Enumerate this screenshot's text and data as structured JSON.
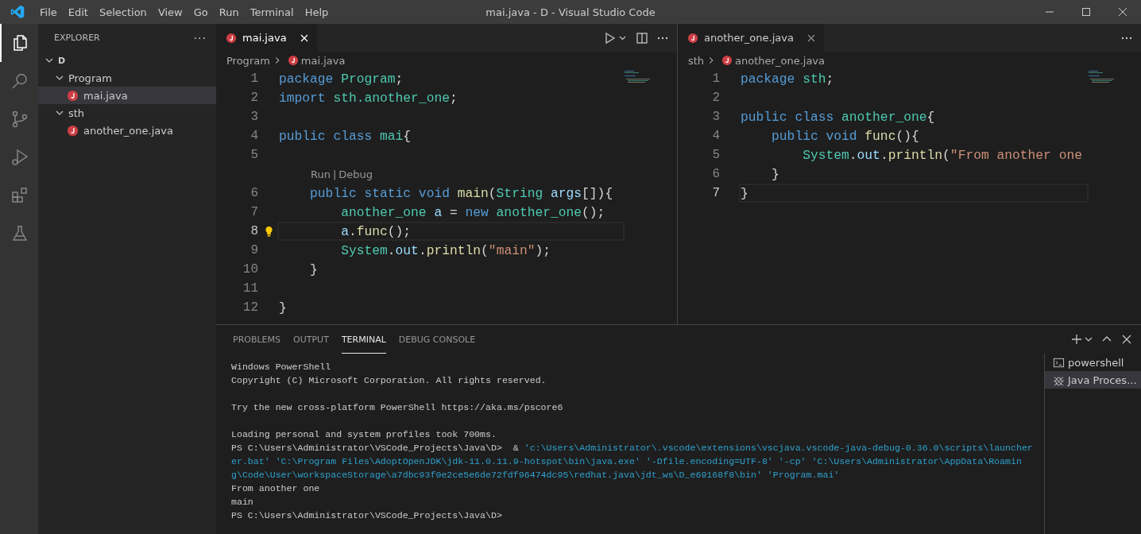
{
  "window": {
    "title": "mai.java - D - Visual Studio Code"
  },
  "menu": [
    "File",
    "Edit",
    "Selection",
    "View",
    "Go",
    "Run",
    "Terminal",
    "Help"
  ],
  "activity_bar": [
    {
      "kind": "files",
      "selected": true
    },
    {
      "kind": "search",
      "selected": false
    },
    {
      "kind": "source-control",
      "selected": false
    },
    {
      "kind": "run-debug",
      "selected": false
    },
    {
      "kind": "extensions",
      "selected": false
    },
    {
      "kind": "testing",
      "selected": false
    }
  ],
  "explorer": {
    "title": "EXPLORER",
    "more": "···",
    "tree": [
      {
        "label": "D",
        "kind": "folder",
        "expanded": true,
        "selected": false,
        "children": [
          {
            "label": "Program",
            "kind": "folder",
            "expanded": true,
            "selected": false,
            "children": [
              {
                "label": "mai.java",
                "kind": "java",
                "selected": true
              }
            ]
          },
          {
            "label": "sth",
            "kind": "folder",
            "expanded": true,
            "selected": false,
            "children": [
              {
                "label": "another_one.java",
                "kind": "java",
                "selected": false
              }
            ]
          }
        ]
      }
    ]
  },
  "editor_groups": [
    {
      "focused": true,
      "tabs": [
        {
          "label": "mai.java",
          "selected": true
        }
      ],
      "actions": [
        {
          "kind": "run"
        },
        {
          "kind": "split"
        },
        {
          "kind": "more"
        }
      ],
      "breadcrumb": [
        {
          "label": "Program",
          "kind": "folder"
        },
        {
          "label": "mai.java",
          "kind": "java"
        }
      ],
      "lines": [
        {
          "n": "1",
          "tokens": [
            {
              "t": "package ",
              "kind": "kw"
            },
            {
              "t": "Program",
              "kind": "type"
            },
            {
              "t": ";",
              "kind": "plain"
            }
          ]
        },
        {
          "n": "2",
          "tokens": [
            {
              "t": "import ",
              "kind": "kw"
            },
            {
              "t": "sth.another_one",
              "kind": "type"
            },
            {
              "t": ";",
              "kind": "plain"
            }
          ]
        },
        {
          "n": "3"
        },
        {
          "n": "4",
          "tokens": [
            {
              "t": "public class ",
              "kind": "kw"
            },
            {
              "t": "mai",
              "kind": "type"
            },
            {
              "t": "{",
              "kind": "plain"
            }
          ]
        },
        {
          "n": "5"
        },
        {
          "kind": "codelens",
          "links": [
            "Run",
            "Debug"
          ],
          "separator": "|"
        },
        {
          "n": "6",
          "tokens": [
            {
              "t": "    public static void ",
              "kind": "kw"
            },
            {
              "t": "main",
              "kind": "fn"
            },
            {
              "t": "(",
              "kind": "plain"
            },
            {
              "t": "String",
              "kind": "type"
            },
            {
              "t": " args",
              "kind": "var"
            },
            {
              "t": "[]){",
              "kind": "plain"
            }
          ]
        },
        {
          "n": "7",
          "tokens": [
            {
              "t": "        another_one",
              "kind": "type"
            },
            {
              "t": " a",
              "kind": "var"
            },
            {
              "t": " = ",
              "kind": "plain"
            },
            {
              "t": "new ",
              "kind": "kw"
            },
            {
              "t": "another_one",
              "kind": "type"
            },
            {
              "t": "();",
              "kind": "plain"
            }
          ]
        },
        {
          "n": "8",
          "current": true,
          "lightbulb": true,
          "tokens": [
            {
              "t": "        a",
              "kind": "var"
            },
            {
              "t": ".",
              "kind": "plain"
            },
            {
              "t": "func",
              "kind": "fn"
            },
            {
              "t": "();",
              "kind": "plain"
            }
          ]
        },
        {
          "n": "9",
          "tokens": [
            {
              "t": "        System",
              "kind": "type"
            },
            {
              "t": ".",
              "kind": "plain"
            },
            {
              "t": "out",
              "kind": "var"
            },
            {
              "t": ".",
              "kind": "plain"
            },
            {
              "t": "println",
              "kind": "fn"
            },
            {
              "t": "(",
              "kind": "plain"
            },
            {
              "t": "\"main\"",
              "kind": "str"
            },
            {
              "t": ");",
              "kind": "plain"
            }
          ]
        },
        {
          "n": "10",
          "tokens": [
            {
              "t": "    }",
              "kind": "plain"
            }
          ]
        },
        {
          "n": "11"
        },
        {
          "n": "12",
          "tokens": [
            {
              "t": "}",
              "kind": "plain"
            }
          ]
        }
      ]
    },
    {
      "focused": false,
      "tabs": [
        {
          "label": "another_one.java",
          "selected": true
        }
      ],
      "actions": [
        {
          "kind": "more"
        }
      ],
      "breadcrumb": [
        {
          "label": "sth",
          "kind": "folder"
        },
        {
          "label": "another_one.java",
          "kind": "java"
        }
      ],
      "lines": [
        {
          "n": "1",
          "tokens": [
            {
              "t": "package ",
              "kind": "kw"
            },
            {
              "t": "sth",
              "kind": "type"
            },
            {
              "t": ";",
              "kind": "plain"
            }
          ]
        },
        {
          "n": "2"
        },
        {
          "n": "3",
          "tokens": [
            {
              "t": "public class ",
              "kind": "kw"
            },
            {
              "t": "another_one",
              "kind": "type"
            },
            {
              "t": "{",
              "kind": "plain"
            }
          ]
        },
        {
          "n": "4",
          "tokens": [
            {
              "t": "    public void ",
              "kind": "kw"
            },
            {
              "t": "func",
              "kind": "fn"
            },
            {
              "t": "(){",
              "kind": "plain"
            }
          ]
        },
        {
          "n": "5",
          "tokens": [
            {
              "t": "        System",
              "kind": "type"
            },
            {
              "t": ".",
              "kind": "plain"
            },
            {
              "t": "out",
              "kind": "var"
            },
            {
              "t": ".",
              "kind": "plain"
            },
            {
              "t": "println",
              "kind": "fn"
            },
            {
              "t": "(",
              "kind": "plain"
            },
            {
              "t": "\"From another one",
              "kind": "str"
            }
          ]
        },
        {
          "n": "6",
          "tokens": [
            {
              "t": "    }",
              "kind": "plain"
            }
          ]
        },
        {
          "n": "7",
          "current": true,
          "tokens": [
            {
              "t": "}",
              "kind": "plain"
            }
          ]
        }
      ]
    }
  ],
  "panel": {
    "tabs": [
      {
        "label": "PROBLEMS",
        "selected": false
      },
      {
        "label": "OUTPUT",
        "selected": false
      },
      {
        "label": "TERMINAL",
        "selected": true
      },
      {
        "label": "DEBUG CONSOLE",
        "selected": false
      }
    ],
    "actions": [
      {
        "kind": "new"
      },
      {
        "kind": "dropdown"
      },
      {
        "kind": "maximize"
      },
      {
        "kind": "close"
      }
    ],
    "terminal": [
      {
        "segments": [
          {
            "t": "Windows PowerShell",
            "kind": "plain"
          }
        ]
      },
      {
        "segments": [
          {
            "t": "Copyright (C) Microsoft Corporation. All rights reserved.",
            "kind": "plain"
          }
        ]
      },
      {
        "gap_before": true,
        "segments": [
          {
            "t": "Try the new cross-platform PowerShell https://aka.ms/pscore6",
            "kind": "plain"
          }
        ]
      },
      {
        "gap_before": true,
        "segments": [
          {
            "t": "Loading personal and system profiles took 700ms.",
            "kind": "plain"
          }
        ]
      },
      {
        "segments": [
          {
            "t": "PS C:\\Users\\Administrator\\VSCode_Projects\\Java\\D>  & ",
            "kind": "plain"
          },
          {
            "t": "'c:\\Users\\Administrator\\.vscode\\extensions\\vscjava.vscode-java-debug-0.36.0\\scripts\\launcher",
            "kind": "path"
          }
        ]
      },
      {
        "segments": [
          {
            "t": "er.bat' 'C:\\Program Files\\AdoptOpenJDK\\jdk-11.0.11.9-hotspot\\bin\\java.exe' '-Dfile.encoding=UTF-8' '-cp' 'C:\\Users\\Administrator\\AppData\\Roamin",
            "kind": "path"
          }
        ]
      },
      {
        "segments": [
          {
            "t": "g\\Code\\User\\workspaceStorage\\a7dbc93f0e2ce5e6de72fdf96474dc95\\redhat.java\\jdt_ws\\D_e69168f8\\bin' 'Program.mai'",
            "kind": "path"
          }
        ]
      },
      {
        "segments": [
          {
            "t": "From another one",
            "kind": "plain"
          }
        ]
      },
      {
        "segments": [
          {
            "t": "main",
            "kind": "plain"
          }
        ]
      },
      {
        "segments": [
          {
            "t": "PS C:\\Users\\Administrator\\VSCode_Projects\\Java\\D>",
            "kind": "plain"
          }
        ]
      }
    ],
    "terminals": [
      {
        "label": "powershell",
        "kind": "shell",
        "selected": false
      },
      {
        "label": "Java Proces...",
        "kind": "debug",
        "selected": true
      }
    ]
  }
}
